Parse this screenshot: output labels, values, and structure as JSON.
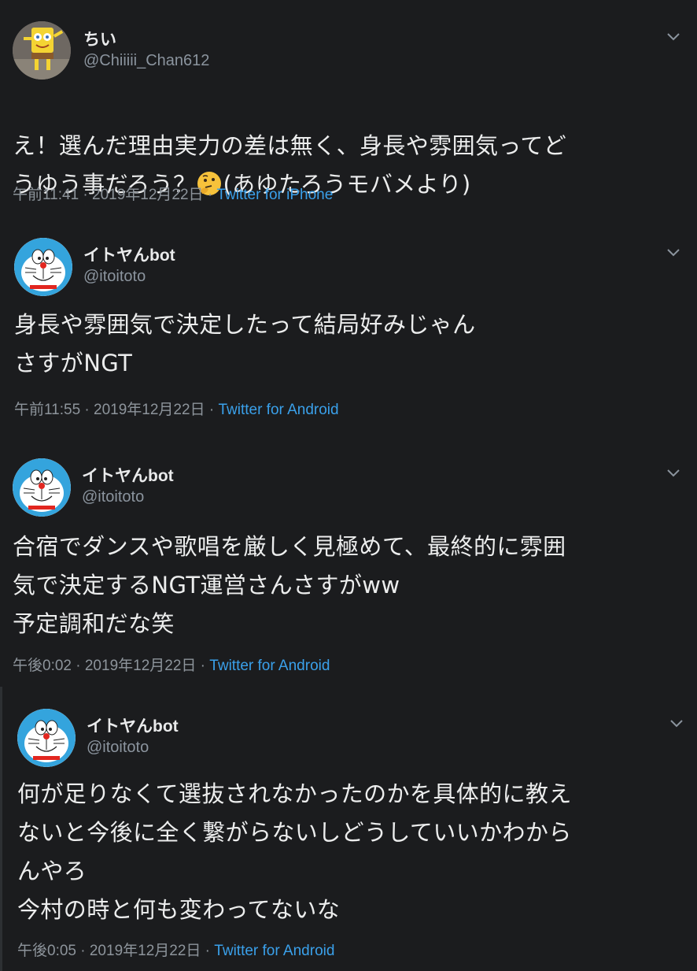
{
  "tweets": [
    {
      "name": "ちい",
      "handle": "@Chiiiii_Chan612",
      "text": "え！選んだ理由実力の差は無く、身長や雰囲気ってど\nうゆう事だろう？",
      "text_after_emoji": "(あゆたろうモバメより)",
      "emoji": "thinking-face",
      "time": "午前11:41 · 2019年12月22日 · ",
      "source": "Twitter for iPhone",
      "avatar": "spongebob-avatar"
    },
    {
      "name": "イトヤんbot",
      "handle": "@itoitoto",
      "text": "身長や雰囲気で決定したって結局好みじゃん\nさすがNGT",
      "time": "午前11:55 · 2019年12月22日 · ",
      "source": "Twitter for Android",
      "avatar": "doraemon-avatar"
    },
    {
      "name": "イトヤんbot",
      "handle": "@itoitoto",
      "text": "合宿でダンスや歌唱を厳しく見極めて、最終的に雰囲\n気で決定するNGT運営さんさすがww\n予定調和だな笑",
      "time": "午後0:02 · 2019年12月22日 · ",
      "source": "Twitter for Android",
      "avatar": "doraemon-avatar"
    },
    {
      "name": "イトヤんbot",
      "handle": "@itoitoto",
      "text": "何が足りなくて選抜されなかったのかを具体的に教え\nないと今後に全く繋がらないしどうしていいかわから\nんやろ\n今村の時と何も変わってないな",
      "time": "午後0:05 · 2019年12月22日 · ",
      "source": "Twitter for Android",
      "avatar": "doraemon-avatar"
    }
  ],
  "colors": {
    "background": "#1b1c1e",
    "link": "#3aa0ea",
    "secondary_text": "#8d949b",
    "primary_text": "#eceded"
  }
}
